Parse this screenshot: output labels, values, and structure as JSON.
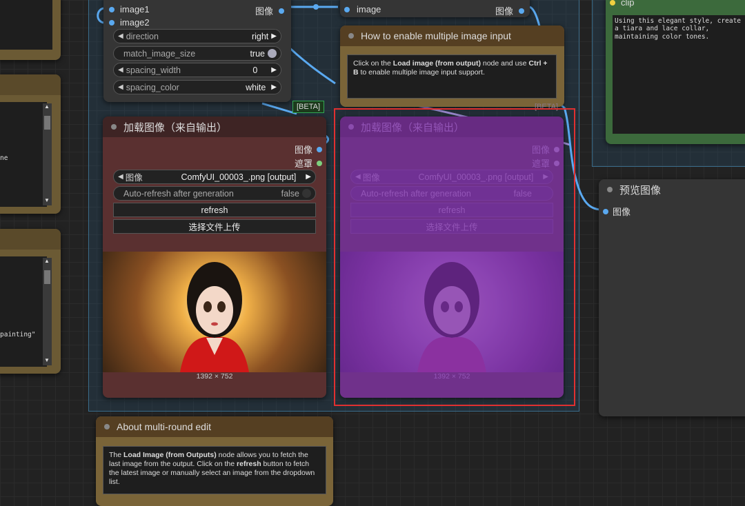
{
  "top_node": {
    "inputs": [
      "image1",
      "image2"
    ],
    "output": "图像",
    "widgets": [
      {
        "label": "direction",
        "value": "right"
      },
      {
        "label": "match_image_size",
        "value": "true"
      },
      {
        "label": "spacing_width",
        "value": "0"
      },
      {
        "label": "spacing_color",
        "value": "white"
      }
    ]
  },
  "preview_top": {
    "input": "image",
    "output": "图像"
  },
  "how_to_note": {
    "title": "How to enable multiple image input",
    "text_pre": "Click on the ",
    "bold1": "Load image (from output)",
    "text_mid": " node and use ",
    "bold2": "Ctrl + B",
    "text_post": " to enable multiple image input support."
  },
  "beta_label": "[BETA]",
  "load_node": {
    "title": "加载图像（来自输出）",
    "outputs": [
      "图像",
      "遮罩"
    ],
    "image_select": {
      "label": "图像",
      "value": "ComfyUI_00003_.png [output]"
    },
    "auto_refresh": {
      "label": "Auto-refresh after generation",
      "value": "false"
    },
    "refresh_button": "refresh",
    "upload_button": "选择文件上传",
    "image_size": "1392 × 752"
  },
  "clip_node": {
    "input": "clip",
    "text": "Using this elegant style, create a tiara and lace collar, maintaining color tones."
  },
  "preview_node": {
    "title": "预览图像",
    "input": "图像"
  },
  "left_partial": {
    "text1": "ne",
    "text2": "painting\""
  },
  "about_note": {
    "title": "About multi-round edit",
    "text_pre": "The ",
    "bold1": "Load Image (from Outputs)",
    "text_mid": " node allows you to fetch the last image from the output. Click on the ",
    "bold2": "refresh",
    "text_post": " button to fetch the latest image or manually select an image from the dropdown list."
  },
  "colors": {
    "highlight_border": "#e03030",
    "bypass_purple": "#7a2fb0",
    "link_blue": "#5aa9f0"
  }
}
